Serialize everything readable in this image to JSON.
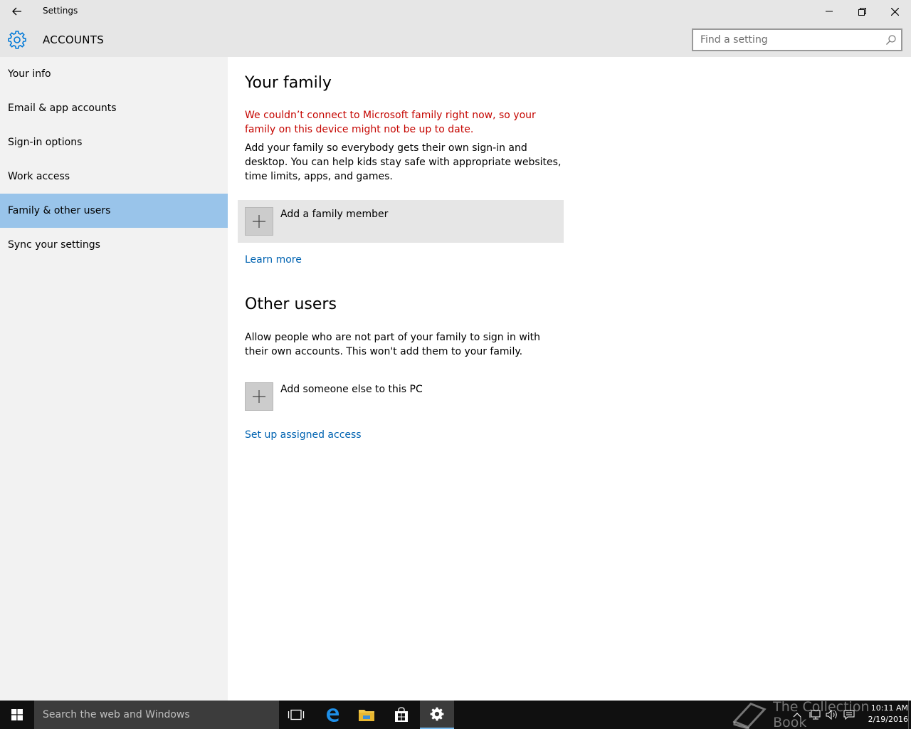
{
  "window": {
    "title": "Settings",
    "minimize_icon": "minimize-icon",
    "maximize_icon": "restore-icon",
    "close_icon": "close-icon"
  },
  "header": {
    "section": "ACCOUNTS",
    "search_placeholder": "Find a setting"
  },
  "sidebar": {
    "items": [
      {
        "label": "Your info"
      },
      {
        "label": "Email & app accounts"
      },
      {
        "label": "Sign-in options"
      },
      {
        "label": "Work access"
      },
      {
        "label": "Family & other users",
        "active": true
      },
      {
        "label": "Sync your settings"
      }
    ]
  },
  "main": {
    "family": {
      "heading": "Your family",
      "error": "We couldn’t connect to Microsoft family right now, so your family on this device might not be up to date.",
      "description": "Add your family so everybody gets their own sign-in and desktop. You can help kids stay safe with appropriate websites, time limits, apps, and games.",
      "add_label": "Add a family member",
      "learn_more": "Learn more"
    },
    "other": {
      "heading": "Other users",
      "description": "Allow people who are not part of your family to sign in with their own accounts. This won't add them to your family.",
      "add_label": "Add someone else to this PC",
      "assigned_access": "Set up assigned access"
    }
  },
  "taskbar": {
    "search_placeholder": "Search the web and Windows",
    "time": "10:11 AM",
    "date": "2/19/2016",
    "watermark": "The Collection Book"
  },
  "colors": {
    "accent": "#0063b1",
    "selection": "#99c4ea",
    "error": "#c50500",
    "chrome": "#e6e6e6",
    "sidebar": "#f2f2f2"
  }
}
